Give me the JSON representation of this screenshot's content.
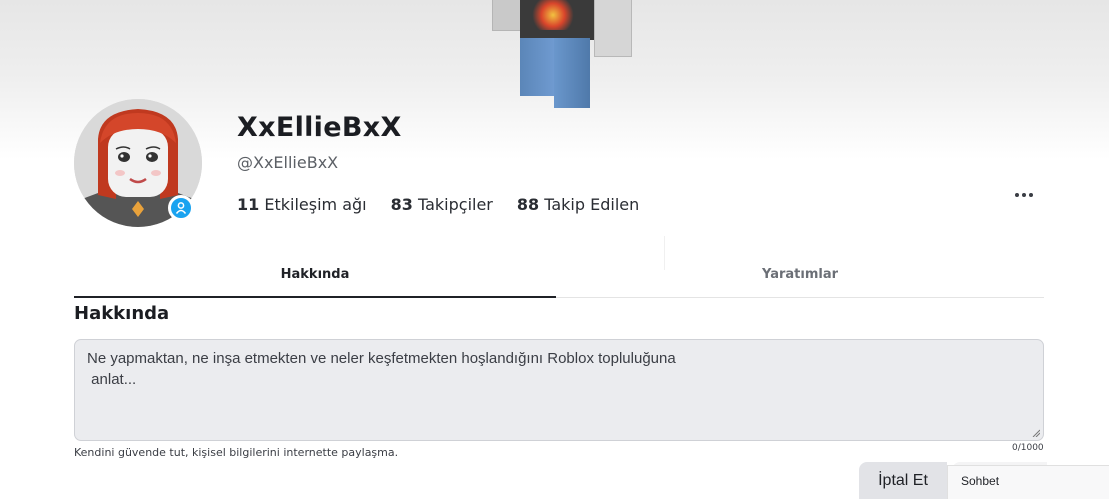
{
  "profile": {
    "display_name": "XxEllieBxX",
    "username": "@XxEllieBxX",
    "stats": [
      {
        "count": "11",
        "label": "Etkileşim ağı"
      },
      {
        "count": "83",
        "label": "Takipçiler"
      },
      {
        "count": "88",
        "label": "Takip Edilen"
      }
    ]
  },
  "tabs": [
    {
      "label": "Hakkında",
      "active": true
    },
    {
      "label": "Yaratımlar",
      "active": false
    }
  ],
  "about": {
    "title": "Hakkında",
    "placeholder": "Ne yapmaktan, ne inşa etmekten ve neler keşfetmekten hoşlandığını Roblox topluluğuna\n anlat...",
    "safety_note": "Kendini güvende tut, kişisel bilgilerini internette paylaşma.",
    "char_count": "0/1000"
  },
  "actions": {
    "cancel_label": "İptal Et"
  },
  "chat": {
    "label": "Sohbet"
  },
  "colors": {
    "presence": "#1aa3f0",
    "tab_active": "#1f2126",
    "textarea_bg": "#ebecef"
  },
  "icons": {
    "presence": "person-icon",
    "more": "more-dots-icon"
  }
}
